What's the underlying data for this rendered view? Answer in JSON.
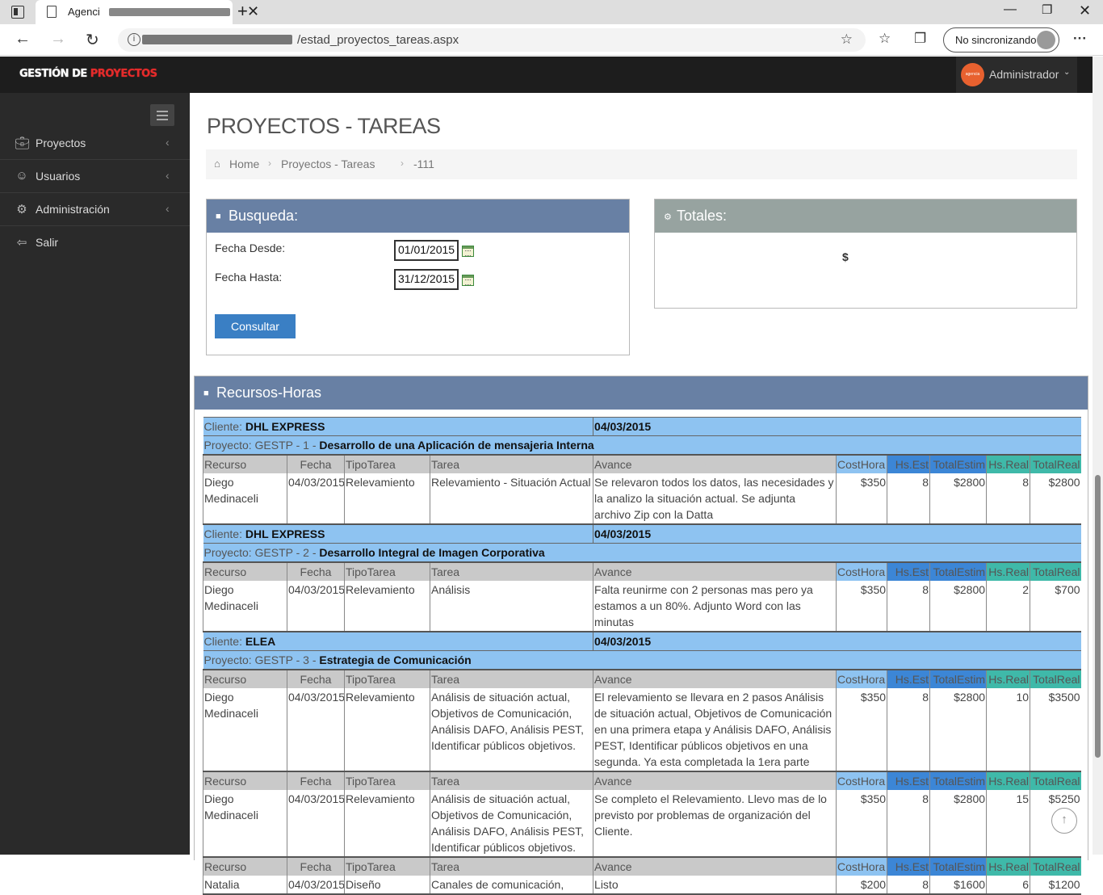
{
  "browser": {
    "tab_title": "Agenci",
    "url_path": "/estad_proyectos_tareas.aspx",
    "sync_label": "No sincronizando"
  },
  "app": {
    "brand_white": "GESTIÓN DE",
    "brand_red": "PROYECTOS",
    "user_name": "Administrador",
    "avatar_text": "agencia Ecoba"
  },
  "sidebar": {
    "items": [
      {
        "label": "Proyectos",
        "icon": "briefcase-icon"
      },
      {
        "label": "Usuarios",
        "icon": "user-icon"
      },
      {
        "label": "Administración",
        "icon": "gear-icon"
      },
      {
        "label": "Salir",
        "icon": "sign-out-icon"
      }
    ]
  },
  "page": {
    "title": "PROYECTOS - TAREAS",
    "breadcrumb": [
      "Home",
      "Proyectos - Tareas",
      "-111"
    ]
  },
  "busqueda": {
    "title": "Busqueda:",
    "fecha_desde_label": "Fecha Desde:",
    "fecha_desde_value": "01/01/2015",
    "fecha_hasta_label": "Fecha Hasta:",
    "fecha_hasta_value": "31/12/2015",
    "consultar_label": "Consultar"
  },
  "totales": {
    "title": "Totales:",
    "value": "$"
  },
  "recursos": {
    "title": "Recursos-Horas",
    "cliente_label": "Cliente:",
    "proyecto_label": "Proyecto:",
    "headers": [
      "Recurso",
      "Fecha",
      "TipoTarea",
      "Tarea",
      "Avance",
      "CostHora",
      "Hs.Est",
      "TotalEstim",
      "Hs.Real",
      "TotalReal"
    ],
    "groups": [
      {
        "cliente": "DHL EXPRESS",
        "fecha": "04/03/2015",
        "proyecto_code": "GESTP - 1 -",
        "proyecto_name": "Desarrollo de una Aplicación de mensajeria Interna",
        "rows": [
          {
            "recurso": "Diego Medinaceli",
            "fecha": "04/03/2015",
            "tipo": "Relevamiento",
            "tarea": "Relevamiento - Situación Actual",
            "avance": "Se relevaron todos los datos, las necesidades y la analizo la situación actual. Se adjunta archivo Zip con la Datta",
            "costhora": "$350",
            "hsest": "8",
            "totalestim": "$2800",
            "hsreal": "8",
            "totalreal": "$2800"
          }
        ]
      },
      {
        "cliente": "DHL EXPRESS",
        "fecha": "04/03/2015",
        "proyecto_code": "GESTP - 2 -",
        "proyecto_name": "Desarrollo Integral de Imagen Corporativa",
        "rows": [
          {
            "recurso": "Diego Medinaceli",
            "fecha": "04/03/2015",
            "tipo": "Relevamiento",
            "tarea": "Análisis",
            "avance": "Falta reunirme con 2 personas mas pero ya estamos a un 80%. Adjunto Word con las minutas",
            "costhora": "$350",
            "hsest": "8",
            "totalestim": "$2800",
            "hsreal": "2",
            "totalreal": "$700"
          }
        ]
      },
      {
        "cliente": "ELEA",
        "fecha": "04/03/2015",
        "proyecto_code": "GESTP - 3 -",
        "proyecto_name": "Estrategia de Comunicación",
        "rows": [
          {
            "recurso": "Diego Medinaceli",
            "fecha": "04/03/2015",
            "tipo": "Relevamiento",
            "tarea": "Análisis de situación actual, Objetivos de Comunicación, Análisis DAFO, Análisis PEST, Identificar públicos objetivos.",
            "avance": "El relevamiento se llevara en 2 pasos Análisis de situación actual, Objetivos de Comunicación en una primera etapa y Análisis DAFO, Análisis PEST, Identificar públicos objetivos en una segunda. Ya esta completada la 1era parte",
            "costhora": "$350",
            "hsest": "8",
            "totalestim": "$2800",
            "hsreal": "10",
            "totalreal": "$3500"
          },
          {
            "recurso": "Diego Medinaceli",
            "fecha": "04/03/2015",
            "tipo": "Relevamiento",
            "tarea": "Análisis de situación actual, Objetivos de Comunicación, Análisis DAFO, Análisis PEST, Identificar públicos objetivos.",
            "avance": "Se completo el Relevamiento. Llevo mas de lo previsto por problemas de organización del Cliente.",
            "costhora": "$350",
            "hsest": "8",
            "totalestim": "$2800",
            "hsreal": "15",
            "totalreal": "$5250"
          },
          {
            "recurso": "Natalia",
            "fecha": "04/03/2015",
            "tipo": "Diseño",
            "tarea": "Canales de comunicación,",
            "avance": "Listo",
            "costhora": "$200",
            "hsest": "8",
            "totalestim": "$1600",
            "hsreal": "6",
            "totalreal": "$1200"
          }
        ]
      }
    ]
  },
  "colors": {
    "header_bg": "#1d1d1d",
    "sidebar_bg": "#2a2a2a",
    "brand_red": "#e52b2b",
    "panel_busqueda": "#6880a4",
    "panel_totales": "#97a3a0",
    "group_row": "#8ec3f1",
    "col_est": "#3c86d6",
    "col_real": "#3fb9a9",
    "button": "#3a7fc4"
  }
}
